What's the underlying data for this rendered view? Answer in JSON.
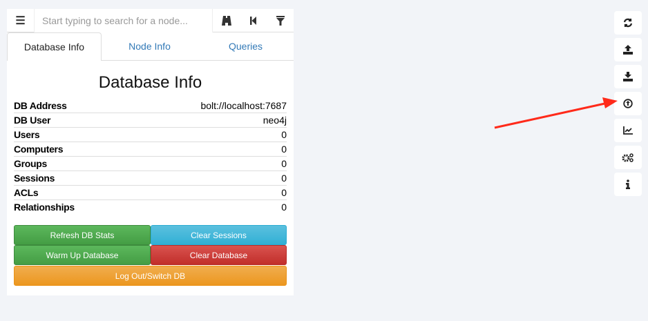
{
  "search": {
    "placeholder": "Start typing to search for a node..."
  },
  "tabs": [
    "Database Info",
    "Node Info",
    "Queries"
  ],
  "title": "Database Info",
  "rows": [
    {
      "k": "DB Address",
      "v": "bolt://localhost:7687"
    },
    {
      "k": "DB User",
      "v": "neo4j"
    },
    {
      "k": "Users",
      "v": "0"
    },
    {
      "k": "Computers",
      "v": "0"
    },
    {
      "k": "Groups",
      "v": "0"
    },
    {
      "k": "Sessions",
      "v": "0"
    },
    {
      "k": "ACLs",
      "v": "0"
    },
    {
      "k": "Relationships",
      "v": "0"
    }
  ],
  "buttons": {
    "refresh": "Refresh DB Stats",
    "clear_sessions": "Clear Sessions",
    "warm": "Warm Up Database",
    "clear_db": "Clear Database",
    "logout": "Log Out/Switch DB"
  },
  "annotation": {
    "arrow_color": "#ff2a1a"
  }
}
